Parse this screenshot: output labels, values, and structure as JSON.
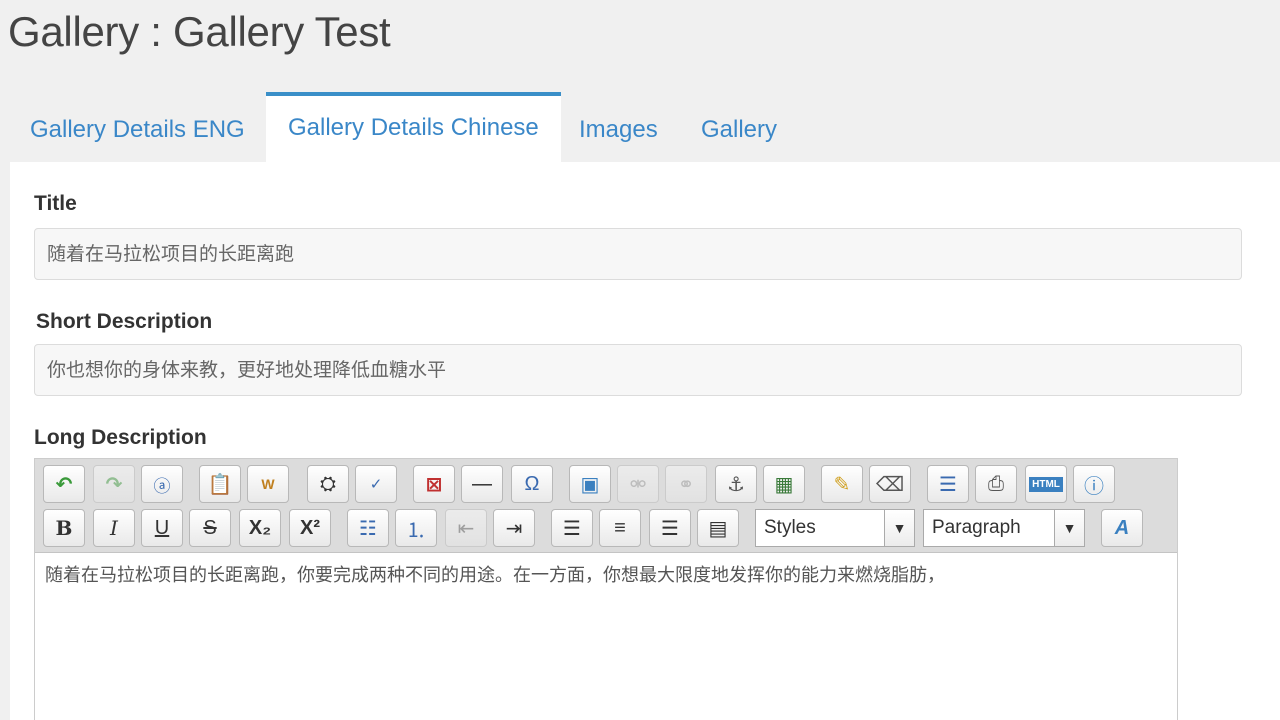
{
  "page": {
    "title": "Gallery : Gallery Test"
  },
  "tabs": [
    {
      "label": "Gallery Details ENG",
      "active": false
    },
    {
      "label": "Gallery Details Chinese",
      "active": true
    },
    {
      "label": "Images",
      "active": false
    },
    {
      "label": "Gallery",
      "active": false
    }
  ],
  "form": {
    "title_label": "Title",
    "title_value": "随着在马拉松项目的长距离跑",
    "short_label": "Short Description",
    "short_value": "你也想你的身体来教，更好地处理降低血糖水平",
    "long_label": "Long Description",
    "long_value": "随着在马拉松项目的长距离跑，你要完成两种不同的用途。在一方面，你想最大限度地发挥你的能力来燃烧脂肪，"
  },
  "editor": {
    "styles_select": "Styles",
    "format_select": "Paragraph",
    "row1_icons": [
      "undo-icon",
      "redo-icon",
      "paste-text-icon",
      "paste-icon",
      "paste-word-icon",
      "find-replace-icon",
      "spellcheck-icon",
      "remove-format-icon",
      "horizontal-rule-icon",
      "special-char-icon",
      "image-icon",
      "unlink-icon",
      "link-icon",
      "anchor-icon",
      "media-icon",
      "highlight-icon",
      "eraser-icon",
      "template-icon",
      "print-icon",
      "html-source-icon",
      "help-icon"
    ],
    "row2_icons": [
      "bold-icon",
      "italic-icon",
      "underline-icon",
      "strikethrough-icon",
      "subscript-icon",
      "superscript-icon",
      "bullet-list-icon",
      "numbered-list-icon",
      "outdent-icon",
      "indent-icon",
      "align-left-icon",
      "align-center-icon",
      "align-right-icon",
      "justify-icon",
      "font-style-icon"
    ]
  },
  "colors": {
    "accent": "#3a87c8",
    "toolbar_bg": "#dcdcdc"
  }
}
